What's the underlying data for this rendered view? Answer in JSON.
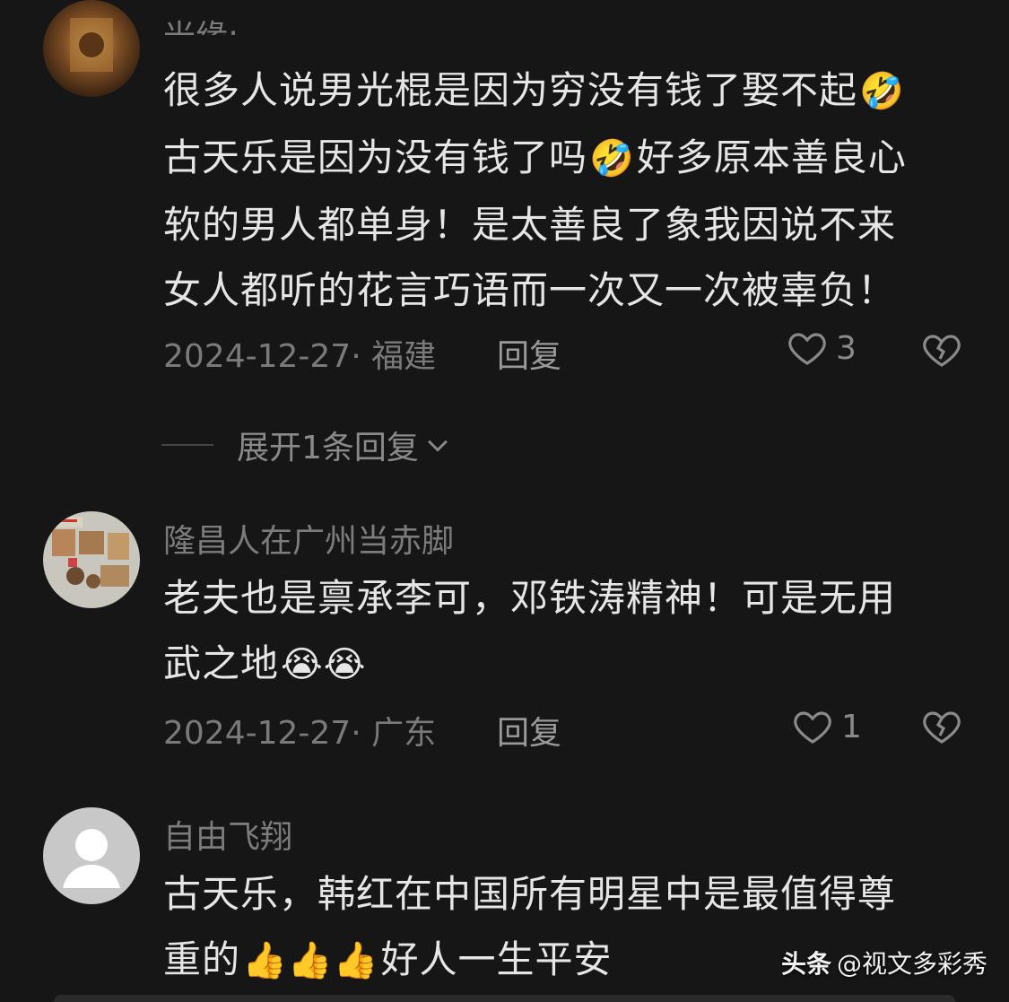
{
  "comments": [
    {
      "author": "光缘:",
      "lines": [
        {
          "text": "很多人说男光棍是因为穷没有钱了娶不起",
          "emoji": "🤣"
        },
        {
          "pre": "古天乐是因为没有钱了吗",
          "emoji": "🤣",
          "post": "好多原本善良心"
        },
        {
          "text": "软的男人都单身！是太善良了象我因说不来"
        },
        {
          "text": "女人都听的花言巧语而一次又一次被辜负！"
        }
      ],
      "date_region": "2024-12-27· 福建",
      "reply_label": "回复",
      "likes": "3"
    },
    {
      "author": "隆昌人在广州当赤脚",
      "lines": [
        {
          "text": "老夫也是禀承李可，邓铁涛精神！可是无用"
        },
        {
          "text": "武之地",
          "emoji": "😭😭"
        }
      ],
      "date_region": "2024-12-27· 广东",
      "reply_label": "回复",
      "likes": "1"
    },
    {
      "author": "自由飞翔",
      "lines": [
        {
          "text": "古天乐，韩红在中国所有明星中是最值得尊"
        },
        {
          "pre": "重的",
          "emoji": "👍👍👍",
          "post": "好人一生平安"
        }
      ]
    }
  ],
  "expand_replies": "展开1条回复",
  "watermark": {
    "brand": "头条",
    "handle": "@视文多彩秀"
  },
  "icons": {
    "like": "heart-outline-icon",
    "dislike": "broken-heart-icon",
    "expand": "chevron-down-icon",
    "default_avatar": "person-silhouette-icon"
  },
  "colors": {
    "background": "#161616",
    "text": "#e6e6e6",
    "muted": "#7a7a7a"
  }
}
